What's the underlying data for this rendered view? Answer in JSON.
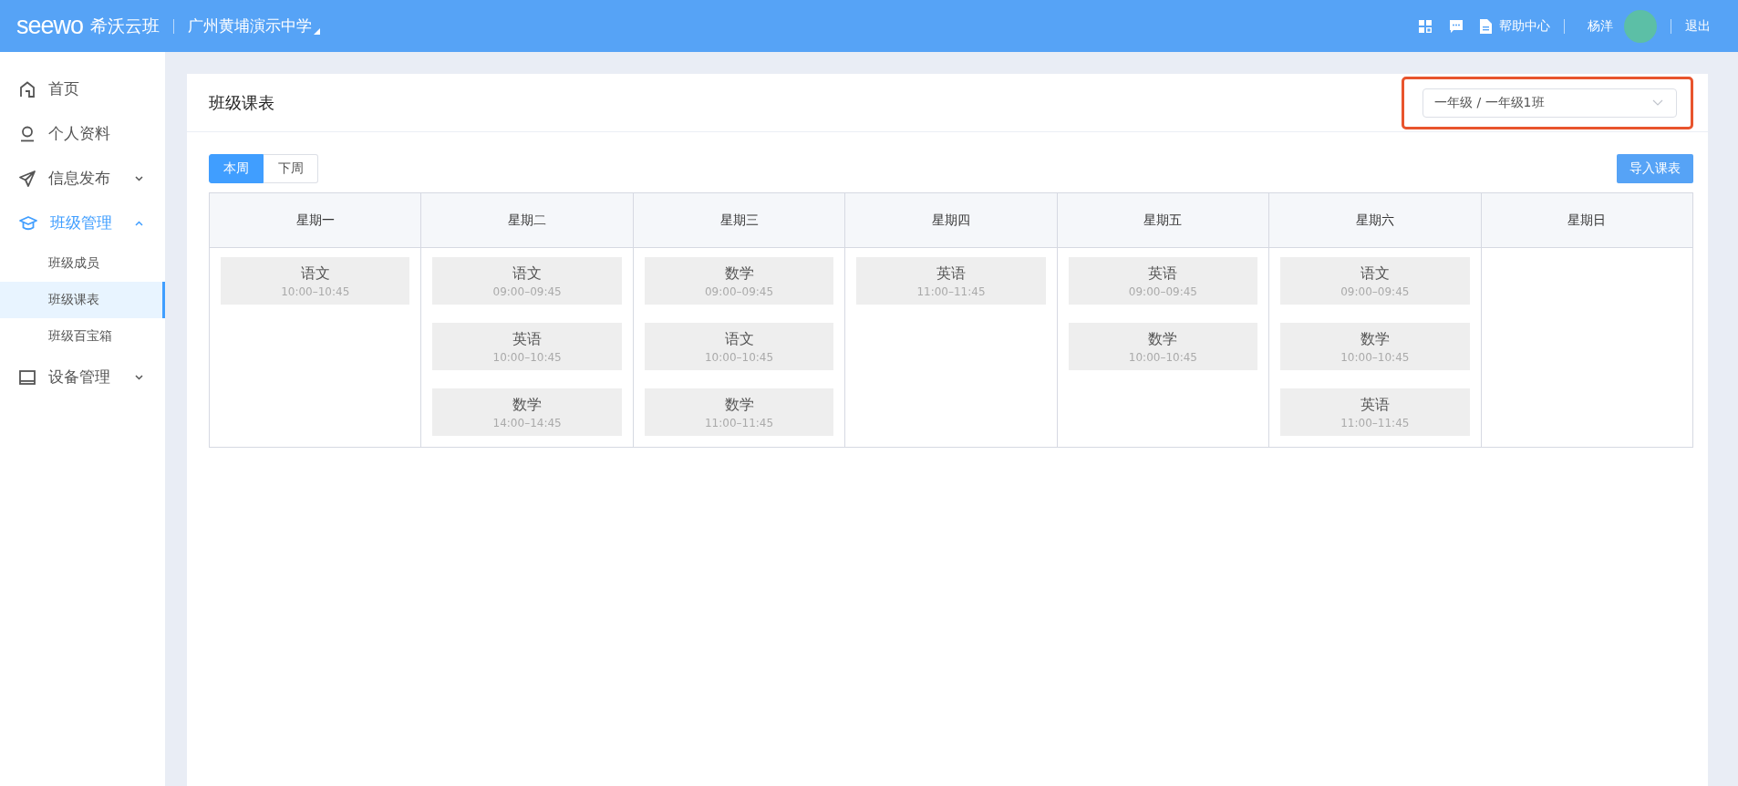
{
  "header": {
    "logo": "seewo",
    "brand": "希沃云班",
    "school": "广州黄埔演示中学",
    "help": "帮助中心",
    "user": "杨洋",
    "logout": "退出"
  },
  "sidebar": {
    "items": [
      {
        "label": "首页",
        "kind": "home",
        "selected": false
      },
      {
        "label": "个人资料",
        "kind": "user",
        "selected": false
      },
      {
        "label": "信息发布",
        "kind": "send",
        "selected": false,
        "expanded": false
      },
      {
        "label": "班级管理",
        "kind": "cap",
        "selected": true,
        "expanded": true,
        "children": [
          {
            "label": "班级成员",
            "selected": false
          },
          {
            "label": "班级课表",
            "selected": true
          },
          {
            "label": "班级百宝箱",
            "selected": false
          }
        ]
      },
      {
        "label": "设备管理",
        "kind": "monitor",
        "selected": false,
        "expanded": false
      }
    ]
  },
  "page_title": "班级课表",
  "class_select": {
    "value": "一年级 / 一年级1班",
    "highlighted": true
  },
  "week_tabs": [
    {
      "label": "本周",
      "selected": true
    },
    {
      "label": "下周",
      "selected": false
    }
  ],
  "import_button": "导入课表",
  "timetable": [
    {
      "day": "星期一",
      "lessons": [
        {
          "subject": "语文",
          "time": "10:00–10:45"
        }
      ]
    },
    {
      "day": "星期二",
      "lessons": [
        {
          "subject": "语文",
          "time": "09:00–09:45"
        },
        {
          "subject": "英语",
          "time": "10:00–10:45"
        },
        {
          "subject": "数学",
          "time": "14:00–14:45"
        }
      ]
    },
    {
      "day": "星期三",
      "lessons": [
        {
          "subject": "数学",
          "time": "09:00–09:45"
        },
        {
          "subject": "语文",
          "time": "10:00–10:45"
        },
        {
          "subject": "数学",
          "time": "11:00–11:45"
        }
      ]
    },
    {
      "day": "星期四",
      "lessons": [
        {
          "subject": "英语",
          "time": "11:00–11:45"
        }
      ]
    },
    {
      "day": "星期五",
      "lessons": [
        {
          "subject": "英语",
          "time": "09:00–09:45"
        },
        {
          "subject": "数学",
          "time": "10:00–10:45"
        }
      ]
    },
    {
      "day": "星期六",
      "lessons": [
        {
          "subject": "语文",
          "time": "09:00–09:45"
        },
        {
          "subject": "数学",
          "time": "10:00–10:45"
        },
        {
          "subject": "英语",
          "time": "11:00–11:45"
        }
      ]
    },
    {
      "day": "星期日"
    }
  ]
}
